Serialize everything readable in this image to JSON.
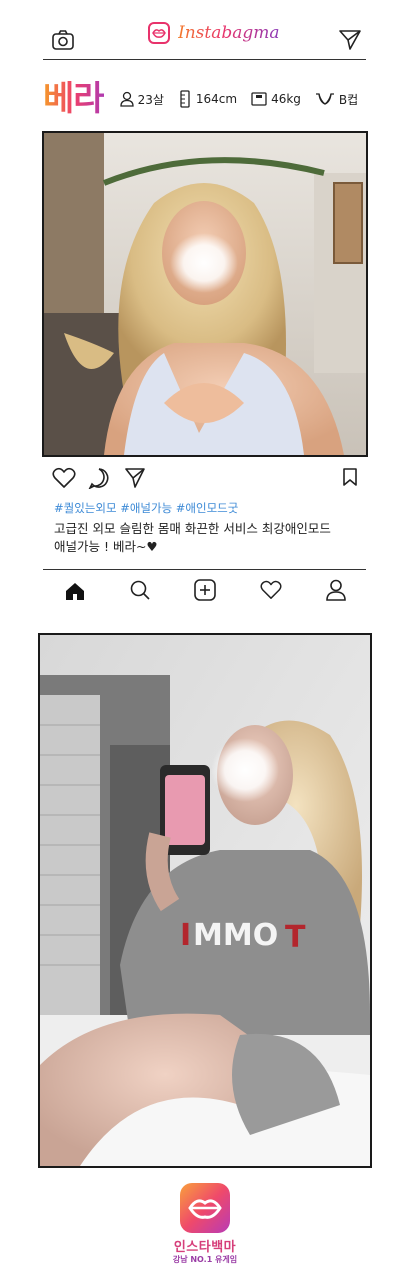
{
  "header": {
    "app_name": "Instabagma",
    "camera_icon": "camera-icon",
    "send_icon": "paper-plane-icon"
  },
  "profile": {
    "name": "베라",
    "age": "23살",
    "height": "164cm",
    "weight": "46kg",
    "cup": "B컵"
  },
  "post": {
    "hashtags": "#퀄있는외모 #애널가능 #애인모드굿",
    "caption_line1": "고급진 외모 슬림한 몸매 화끈한 서비스 최강애인모드",
    "caption_line2": "애널가능 ! 베라~♥",
    "actions": [
      "heart-icon",
      "comment-icon",
      "share-icon",
      "bookmark-icon"
    ]
  },
  "nav": [
    "home-icon",
    "search-icon",
    "add-post-icon",
    "heart-icon",
    "profile-icon"
  ],
  "footer": {
    "title": "인스타백마",
    "subtitle": "강남 NO.1 유게임"
  },
  "colors": {
    "brand_pink": "#e8326b",
    "brand_orange": "#f59b2a",
    "brand_purple": "#b03ab0",
    "hashtag_blue": "#3d8ad6"
  }
}
